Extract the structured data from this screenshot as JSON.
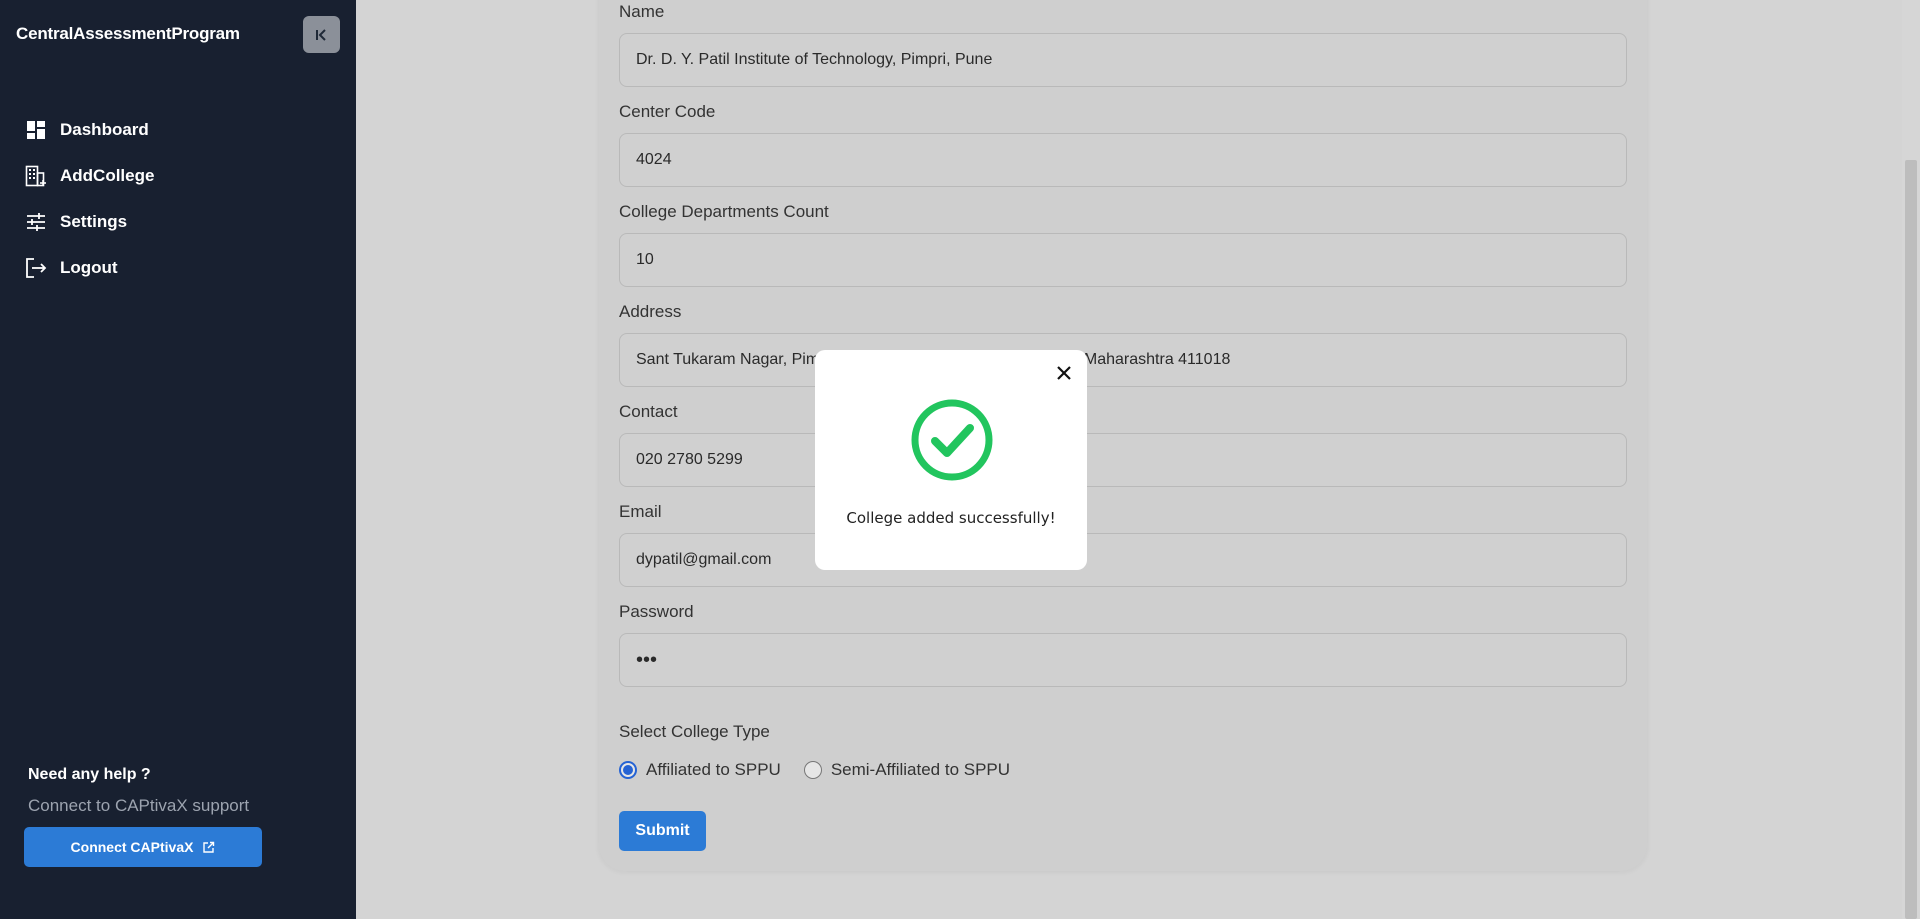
{
  "sidebar": {
    "brand": "CentralAssessmentProgram",
    "items": [
      {
        "label": "Dashboard",
        "icon": "dashboard-icon"
      },
      {
        "label": "AddCollege",
        "icon": "building-add-icon"
      },
      {
        "label": "Settings",
        "icon": "sliders-icon"
      },
      {
        "label": "Logout",
        "icon": "logout-icon"
      }
    ],
    "help": {
      "title": "Need any help ?",
      "subtitle": "Connect to CAPtivaX support",
      "button": "Connect CAPtivaX"
    }
  },
  "form": {
    "fields": [
      {
        "label": "Name",
        "value": "Dr. D. Y. Patil Institute of Technology, Pimpri, Pune"
      },
      {
        "label": "Center Code",
        "value": "4024"
      },
      {
        "label": "College Departments Count",
        "value": "10"
      },
      {
        "label": "Address",
        "value": "Sant Tukaram Nagar, Pimpri Colony, Pune, Pimpri-Chinchwad, Maharashtra 411018"
      },
      {
        "label": "Contact",
        "value": "020 2780 5299"
      },
      {
        "label": "Email",
        "value": "dypatil@gmail.com"
      },
      {
        "label": "Password",
        "value": "•••"
      }
    ],
    "college_type": {
      "label": "Select College Type",
      "options": [
        "Affiliated to SPPU",
        "Semi-Affiliated to SPPU"
      ],
      "selected": "Affiliated to SPPU"
    },
    "submit": "Submit"
  },
  "modal": {
    "message": "College added successfully!",
    "icon": "check-circle-icon",
    "icon_color": "#22c55e"
  },
  "colors": {
    "sidebar_bg": "#182030",
    "accent": "#2c7bd6"
  }
}
